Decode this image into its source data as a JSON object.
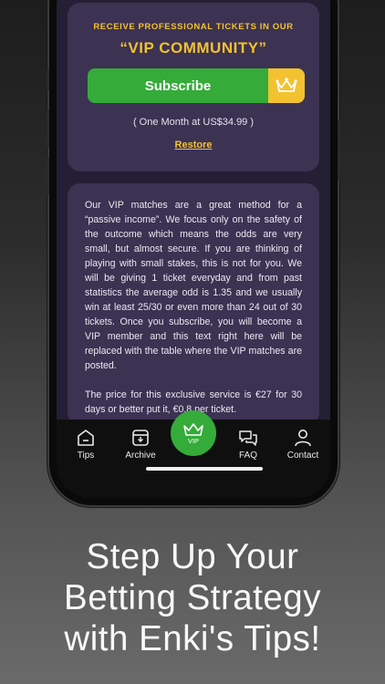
{
  "promo": {
    "line": "RECEIVE PROFESSIONAL TICKETS IN OUR",
    "title": "“VIP COMMUNITY”",
    "subscribe_label": "Subscribe",
    "price_note": "( One Month at US$34.99 )",
    "restore_label": "Restore"
  },
  "description": {
    "paragraph1": "Our VIP matches are a great method for a “passive income”. We focus only on the safety of the outcome which means the odds are very small, but almost secure. If you are thinking of playing with small stakes, this is not for you. We will be giving 1 ticket everyday and from past statistics the average odd is 1.35 and we usually win at least 25/30 or even more than 24 out of 30 tickets. Once you subscribe, you will become a VIP member and this text right here will be replaced with the table where the VIP matches are posted.",
    "paragraph2": "The price for this exclusive service is €27 for 30 days or better put it, €0.8 per ticket."
  },
  "tabs": {
    "tips": "Tips",
    "archive": "Archive",
    "vip": "VIP",
    "faq": "FAQ",
    "contact": "Contact"
  },
  "headline": {
    "line1": "Step Up Your",
    "line2": "Betting Strategy",
    "line3": "with Enki's Tips!"
  },
  "colors": {
    "accent_gold": "#f2c230",
    "accent_green": "#35ab3a",
    "card_bg": "#3c3252",
    "screen_bg": "#241f35"
  },
  "icons": [
    "home-icon",
    "archive-icon",
    "crown-icon",
    "faq-icon",
    "user-icon"
  ]
}
